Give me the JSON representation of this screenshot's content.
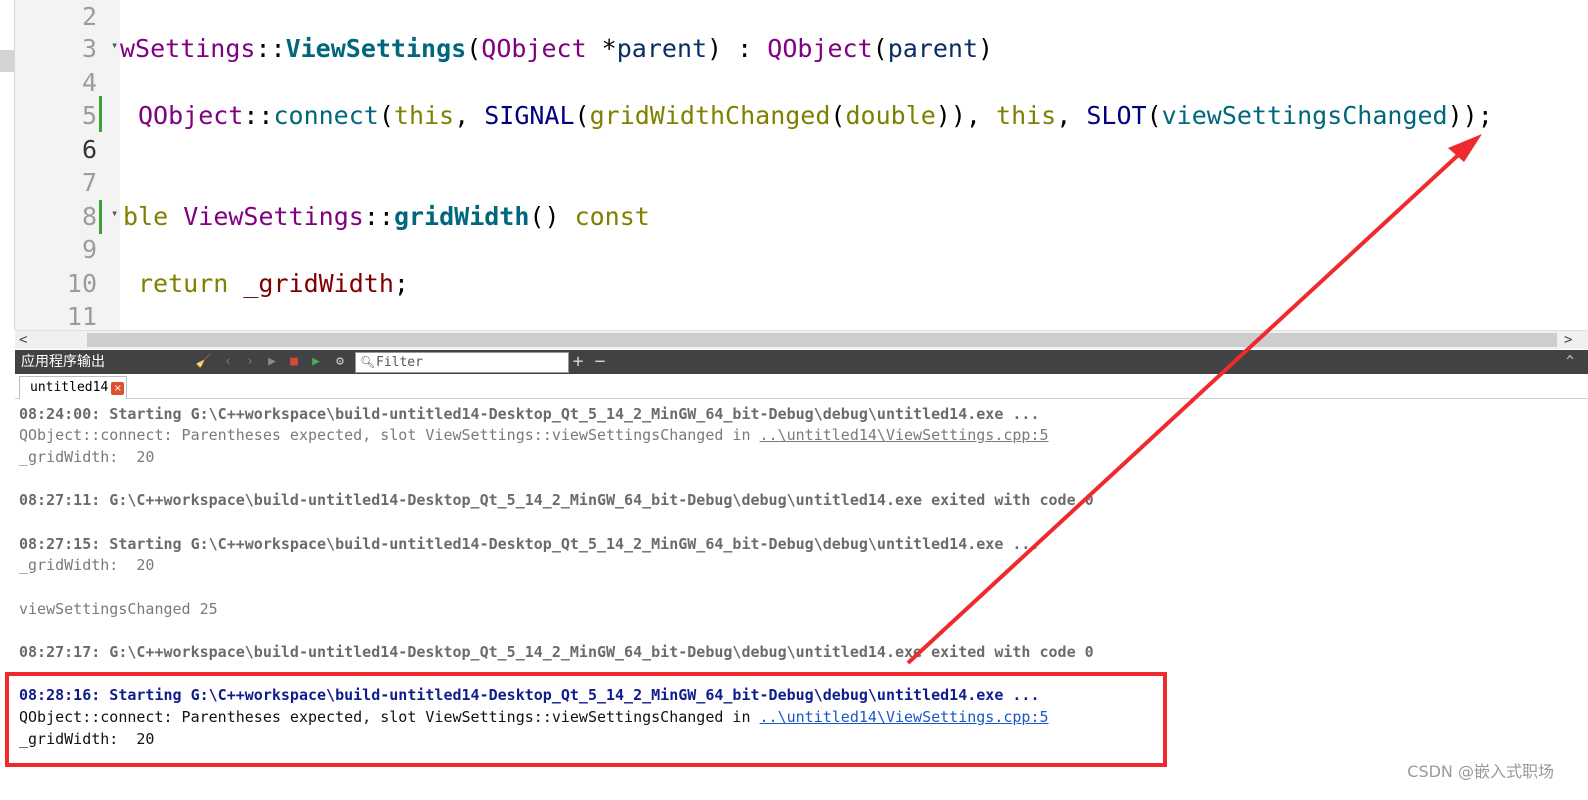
{
  "editor": {
    "line_numbers": [
      "2",
      "3",
      "4",
      "5",
      "6",
      "7",
      "8",
      "9",
      "10",
      "11"
    ],
    "current_line": "6",
    "line3": {
      "p1": "wSettings",
      "p2": "::",
      "p3": "ViewSettings",
      "p4": "(",
      "p5": "QObject",
      "p6": " *",
      "p7": "parent",
      "p8": ") : ",
      "p9": "QObject",
      "p10": "(",
      "p11": "parent",
      "p12": ")"
    },
    "line5": {
      "p1": "QObject",
      "p2": "::",
      "p3": "connect",
      "p4": "(",
      "p5": "this",
      "p6": ", ",
      "p7": "SIGNAL",
      "p8": "(",
      "p9": "gridWidthChanged",
      "p10": "(",
      "p11": "double",
      "p12": ")), ",
      "p13": "this",
      "p14": ", ",
      "p15": "SLOT",
      "p16": "(",
      "p17": "viewSettingsChanged",
      "p18": "));"
    },
    "line8": {
      "p1": "ble ",
      "p2": "ViewSettings",
      "p3": "::",
      "p4": "gridWidth",
      "p5": "() ",
      "p6": "const"
    },
    "line10": {
      "p1": "return ",
      "p2": "_gridWidth",
      "p3": ";"
    }
  },
  "scrollbar": {
    "left": "<",
    "right": ">"
  },
  "pane": {
    "title": "应用程序输出",
    "filter_placeholder": "Filter",
    "add": "+",
    "remove": "−",
    "close": "^"
  },
  "tab": {
    "label": "untitled14",
    "close": "×"
  },
  "output": [
    {
      "style": "bold",
      "text": "08:24:00: Starting G:\\C++workspace\\build-untitled14-Desktop_Qt_5_14_2_MinGW_64_bit-Debug\\debug\\untitled14.exe ..."
    },
    {
      "style": "grey",
      "text": "QObject::connect: Parentheses expected, slot ViewSettings::viewSettingsChanged in ",
      "link": "..\\untitled14\\ViewSettings.cpp:5"
    },
    {
      "style": "grey",
      "text": "_gridWidth:  20"
    },
    {
      "style": "bold",
      "text": "08:27:11: G:\\C++workspace\\build-untitled14-Desktop_Qt_5_14_2_MinGW_64_bit-Debug\\debug\\untitled14.exe exited with code 0"
    },
    {
      "style": "bold",
      "text": "08:27:15: Starting G:\\C++workspace\\build-untitled14-Desktop_Qt_5_14_2_MinGW_64_bit-Debug\\debug\\untitled14.exe ..."
    },
    {
      "style": "grey",
      "text": "_gridWidth:  20"
    },
    {
      "style": "grey",
      "text": "viewSettingsChanged 25"
    },
    {
      "style": "bold",
      "text": "08:27:17: G:\\C++workspace\\build-untitled14-Desktop_Qt_5_14_2_MinGW_64_bit-Debug\\debug\\untitled14.exe exited with code 0"
    },
    {
      "style": "bold-blue",
      "text": "08:28:16: Starting G:\\C++workspace\\build-untitled14-Desktop_Qt_5_14_2_MinGW_64_bit-Debug\\debug\\untitled14.exe ..."
    },
    {
      "style": "dark",
      "text": "QObject::connect: Parentheses expected, slot ViewSettings::viewSettingsChanged in ",
      "link": "..\\untitled14\\ViewSettings.cpp:5"
    },
    {
      "style": "dark",
      "text": "_gridWidth:  20"
    }
  ],
  "watermark": "CSDN @嵌入式职场",
  "colors": {
    "annotation": "#ee2a2e",
    "toolbar": "#404244",
    "change_bar": "#3ca33c"
  }
}
